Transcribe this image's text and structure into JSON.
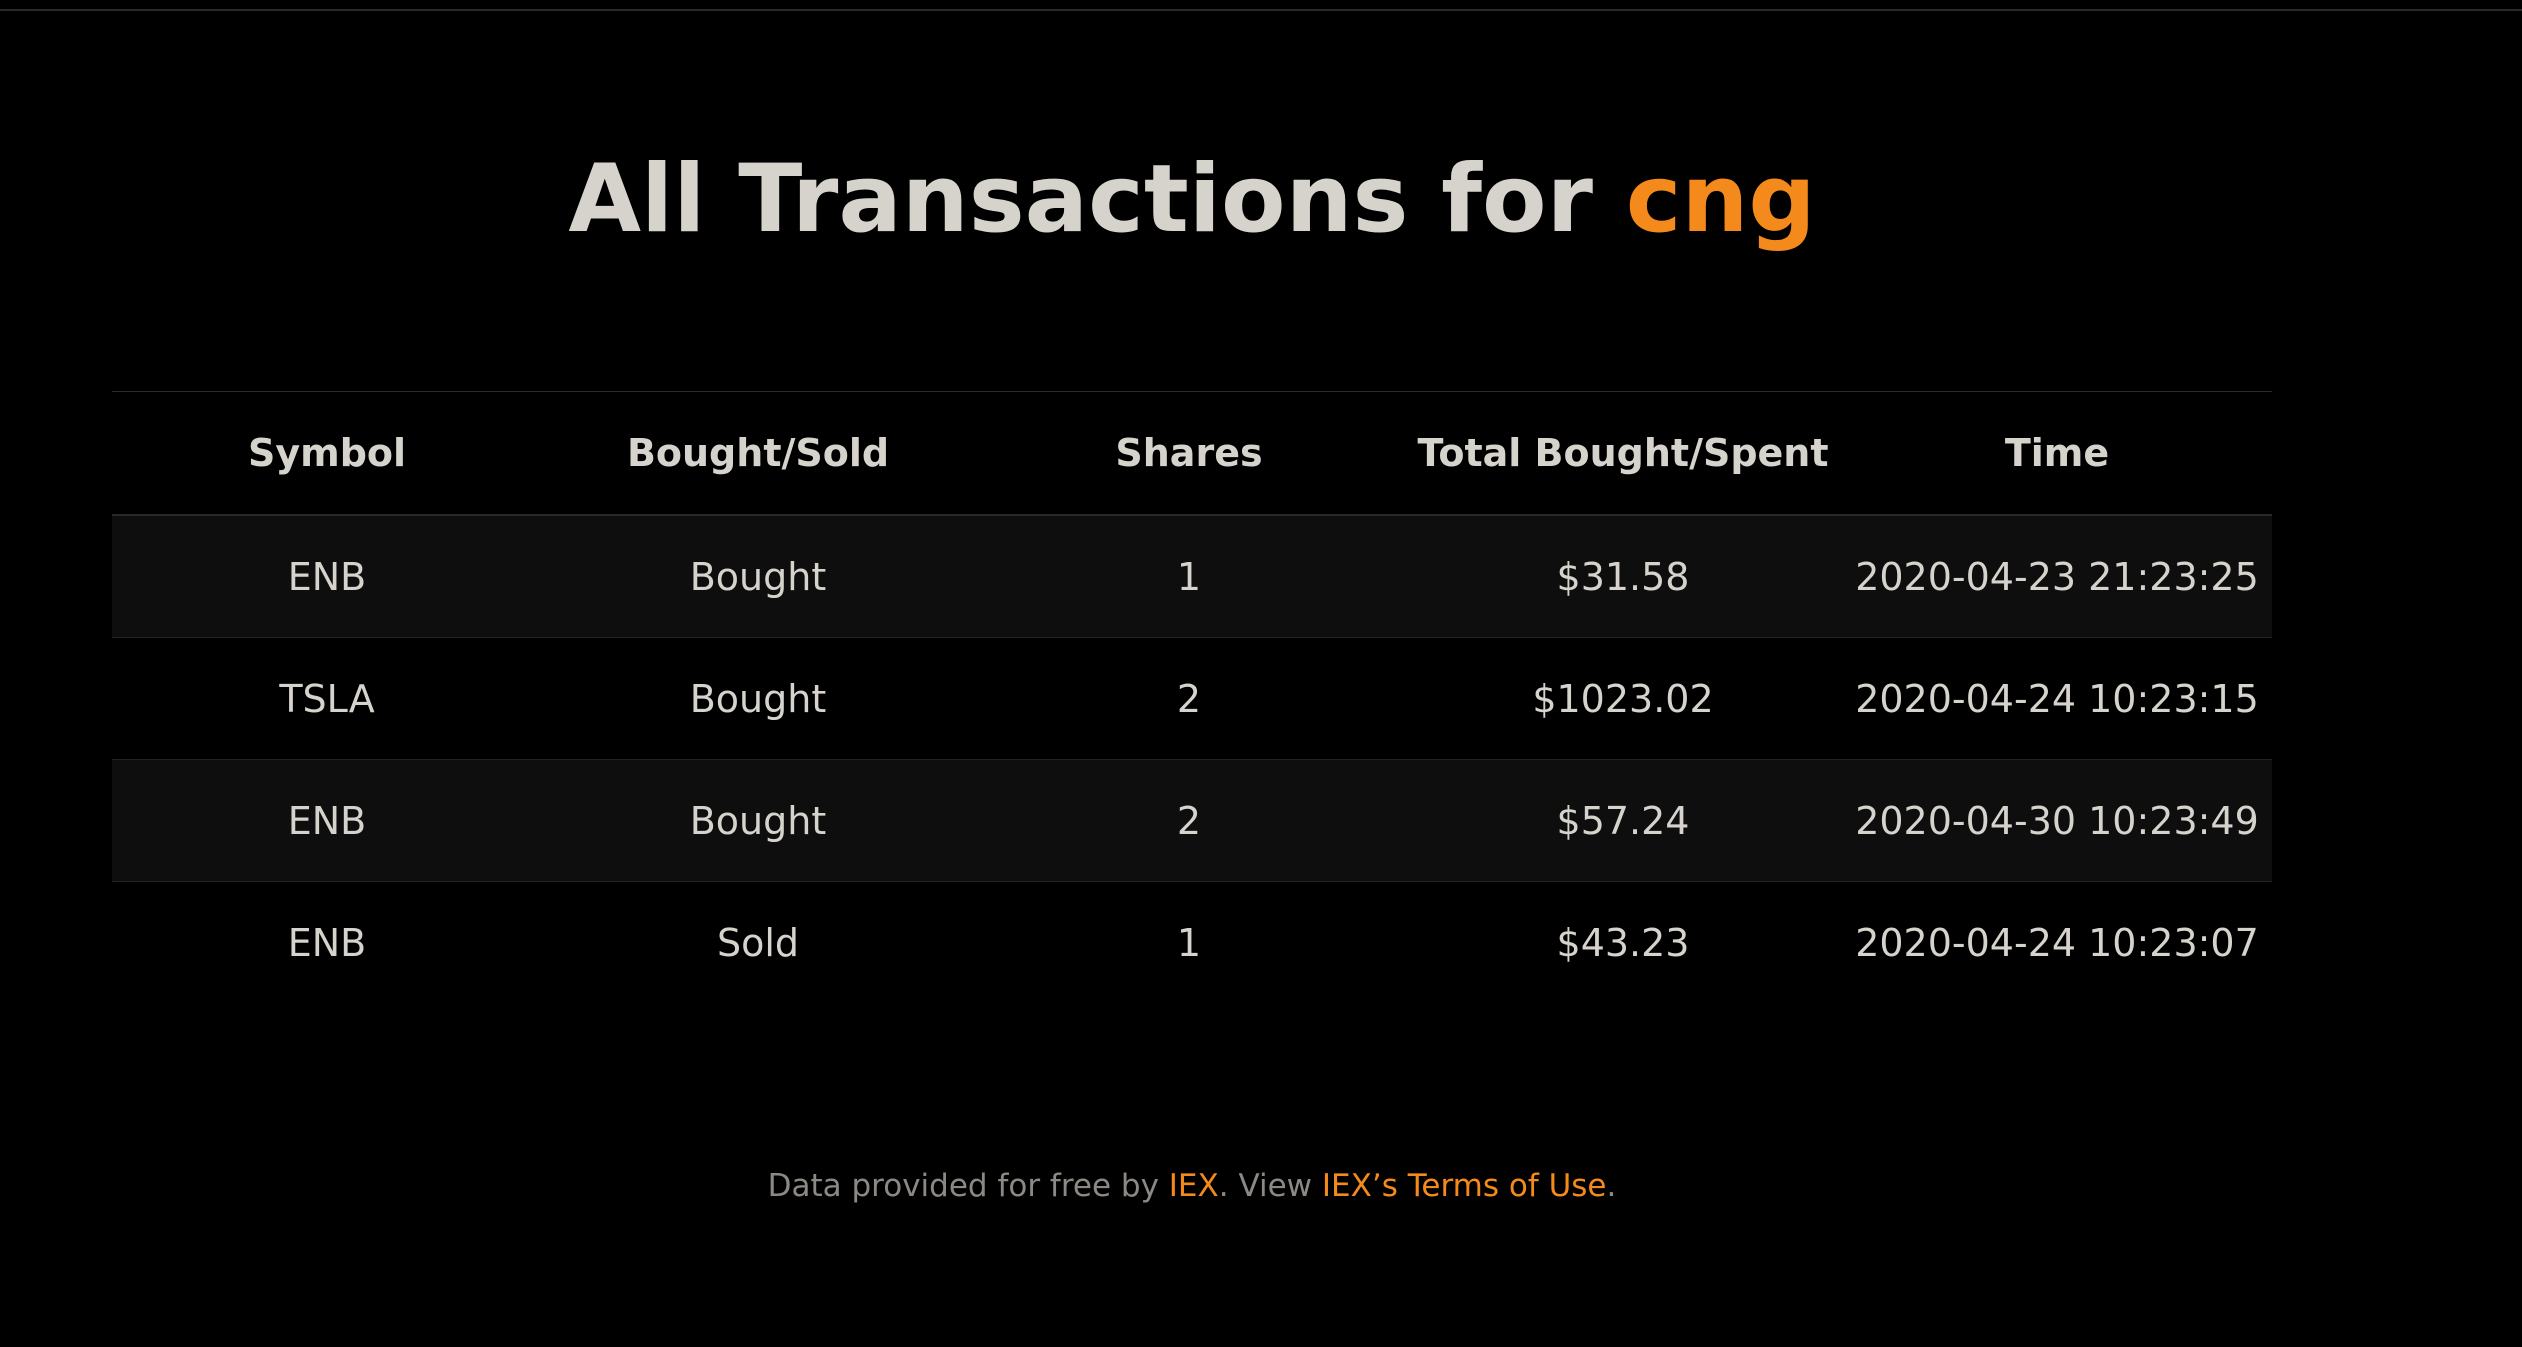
{
  "page": {
    "title_prefix": "All Transactions for",
    "username": "cng"
  },
  "table": {
    "headers": [
      "Symbol",
      "Bought/Sold",
      "Shares",
      "Total Bought/Spent",
      "Time"
    ],
    "rows": [
      {
        "symbol": "ENB",
        "action": "Bought",
        "shares": "1",
        "total": "$31.58",
        "time": "2020-04-23 21:23:25"
      },
      {
        "symbol": "TSLA",
        "action": "Bought",
        "shares": "2",
        "total": "$1023.02",
        "time": "2020-04-24 10:23:15"
      },
      {
        "symbol": "ENB",
        "action": "Bought",
        "shares": "2",
        "total": "$57.24",
        "time": "2020-04-30 10:23:49"
      },
      {
        "symbol": "ENB",
        "action": "Sold",
        "shares": "1",
        "total": "$43.23",
        "time": "2020-04-24 10:23:07"
      }
    ]
  },
  "footer": {
    "text_before": "Data provided for free by ",
    "iex_link": "IEX",
    "text_middle": ". View ",
    "terms_link": "IEX’s Terms of Use",
    "text_after": "."
  },
  "colors": {
    "background": "#000000",
    "text": "#d6d2cc",
    "accent": "#f48a1c",
    "stripe": "#0e0e0e"
  }
}
